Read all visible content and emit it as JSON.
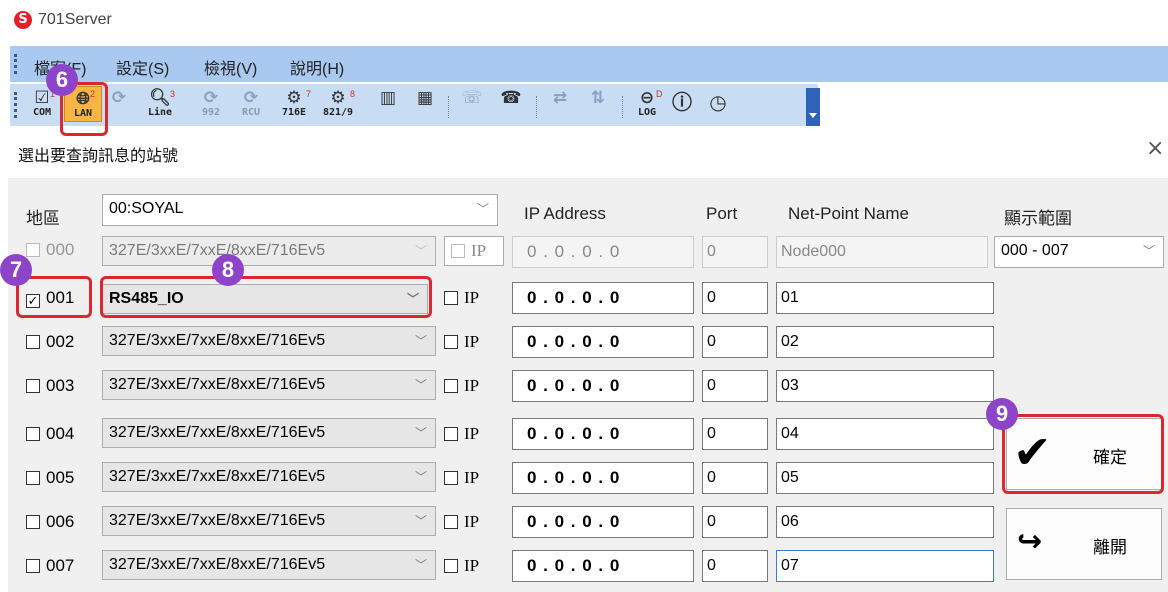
{
  "app": {
    "title": "701Server",
    "logo_letter": "S"
  },
  "menu": {
    "items": [
      "檔案(F)",
      "設定(S)",
      "檢視(V)",
      "說明(H)"
    ]
  },
  "toolbar": {
    "buttons": [
      {
        "label": "COM",
        "num": "1",
        "icon": "com-icon"
      },
      {
        "label": "LAN",
        "num": "2",
        "icon": "lan-icon"
      },
      {
        "label": "",
        "num": "",
        "icon": "refresh-icon"
      },
      {
        "label": "Line",
        "num": "3",
        "icon": "line-icon"
      },
      {
        "label": "992",
        "num": "4",
        "icon": "992-icon"
      },
      {
        "label": "RCU",
        "num": "5",
        "icon": "rcu-icon"
      },
      {
        "label": "716E",
        "num": "7",
        "icon": "716e-icon"
      },
      {
        "label": "821/9",
        "num": "8",
        "icon": "8219-icon"
      },
      {
        "label": "",
        "num": "",
        "icon": "card-h-icon"
      },
      {
        "label": "",
        "num": "",
        "icon": "card-e-icon"
      },
      {
        "label": "",
        "num": "",
        "icon": "phone-icon"
      },
      {
        "label": "",
        "num": "",
        "icon": "phone-down-icon"
      },
      {
        "label": "",
        "num": "",
        "icon": "link-icon"
      },
      {
        "label": "",
        "num": "",
        "icon": "updown-icon"
      },
      {
        "label": "LOG",
        "num": "D",
        "icon": "log-icon"
      },
      {
        "label": "",
        "num": "",
        "icon": "info-icon"
      },
      {
        "label": "",
        "num": "",
        "icon": "clock-download-icon"
      }
    ]
  },
  "dialog": {
    "title": "選出要查詢訊息的站號",
    "area_label": "地區",
    "area_value": "00:SOYAL",
    "headers": {
      "ip": "IP Address",
      "port": "Port",
      "name": "Net-Point Name",
      "range": "顯示範圍"
    },
    "range_value": "000 - 007",
    "ip_toggle_label": "IP",
    "ok_label": "確定",
    "exit_label": "離開",
    "rows": [
      {
        "id": "000",
        "checked": false,
        "disabled": true,
        "device": "327E/3xxE/7xxE/8xxE/716Ev5",
        "ip": "0 . 0 . 0 . 0",
        "port": "0",
        "name": "Node000"
      },
      {
        "id": "001",
        "checked": true,
        "disabled": false,
        "device": "RS485_IO",
        "ip": "0 . 0 . 0 . 0",
        "port": "0",
        "name": "01"
      },
      {
        "id": "002",
        "checked": false,
        "disabled": false,
        "device": "327E/3xxE/7xxE/8xxE/716Ev5",
        "ip": "0 . 0 . 0 . 0",
        "port": "0",
        "name": "02"
      },
      {
        "id": "003",
        "checked": false,
        "disabled": false,
        "device": "327E/3xxE/7xxE/8xxE/716Ev5",
        "ip": "0 . 0 . 0 . 0",
        "port": "0",
        "name": "03"
      },
      {
        "id": "004",
        "checked": false,
        "disabled": false,
        "device": "327E/3xxE/7xxE/8xxE/716Ev5",
        "ip": "0 . 0 . 0 . 0",
        "port": "0",
        "name": "04"
      },
      {
        "id": "005",
        "checked": false,
        "disabled": false,
        "device": "327E/3xxE/7xxE/8xxE/716Ev5",
        "ip": "0 . 0 . 0 . 0",
        "port": "0",
        "name": "05"
      },
      {
        "id": "006",
        "checked": false,
        "disabled": false,
        "device": "327E/3xxE/7xxE/8xxE/716Ev5",
        "ip": "0 . 0 . 0 . 0",
        "port": "0",
        "name": "06"
      },
      {
        "id": "007",
        "checked": false,
        "disabled": false,
        "device": "327E/3xxE/7xxE/8xxE/716Ev5",
        "ip": "0 . 0 . 0 . 0",
        "port": "0",
        "name": "07"
      }
    ]
  },
  "callouts": [
    "6",
    "7",
    "8",
    "9"
  ],
  "colors": {
    "menubar": "#a9c9f0",
    "toolbar": "#c8dcf4",
    "highlight": "#d9292f",
    "badge": "#8e44c8",
    "active_button": "#f7b545"
  }
}
